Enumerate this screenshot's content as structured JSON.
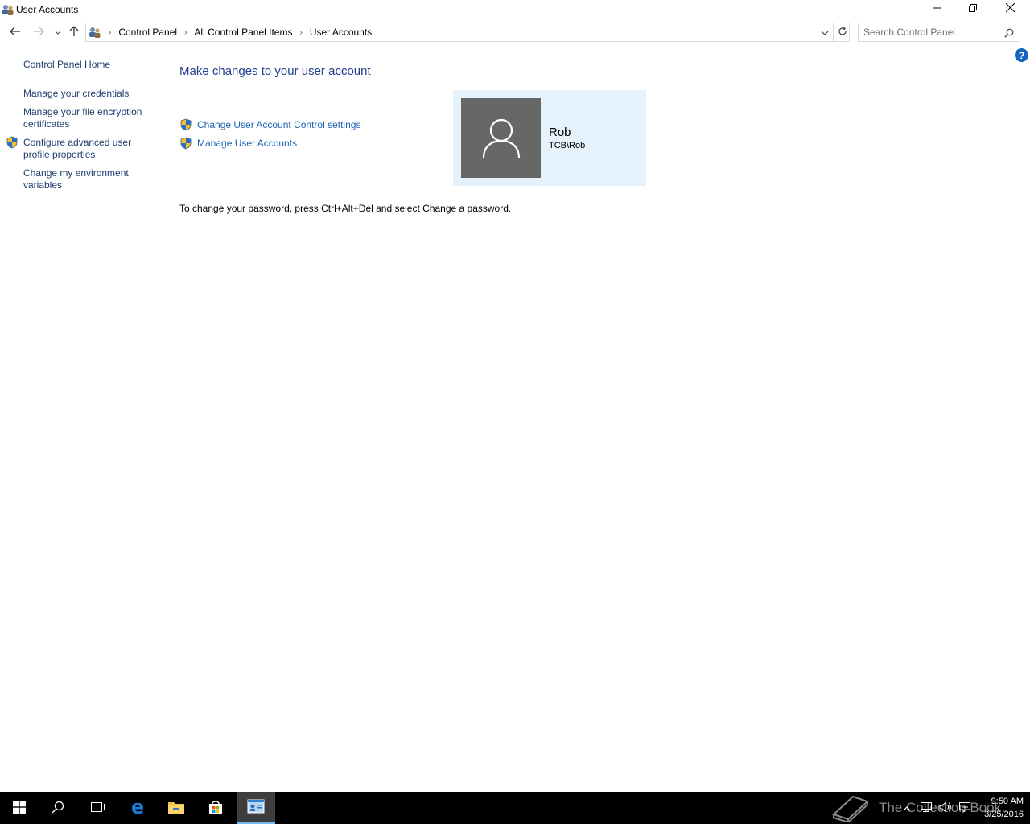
{
  "window": {
    "title": "User Accounts",
    "app_icon": "user-accounts-icon",
    "controls": {
      "minimize": "minimize-icon",
      "restore": "restore-icon",
      "close": "close-icon"
    }
  },
  "nav": {
    "breadcrumbs": [
      "Control Panel",
      "All Control Panel Items",
      "User Accounts"
    ],
    "search_placeholder": "Search Control Panel"
  },
  "sidebar": {
    "home": "Control Panel Home",
    "links": [
      "Manage your credentials",
      "Manage your file encryption certificates",
      "Configure advanced user profile properties",
      "Change my environment variables"
    ]
  },
  "main": {
    "heading": "Make changes to your user account",
    "tasks": [
      "Change User Account Control settings",
      "Manage User Accounts"
    ],
    "user": {
      "name": "Rob",
      "account": "TCB\\Rob"
    },
    "password_note": "To change your password, press Ctrl+Alt+Del and select Change a password."
  },
  "help_label": "?",
  "taskbar": {
    "time": "9:50 AM",
    "date": "3/25/2016",
    "watermark": "The Collection Book"
  },
  "colors": {
    "link": "#1e3e6f",
    "heading": "#1e3e8e",
    "user_panel": "#e5f1fb",
    "avatar_bg": "#676767",
    "taskbar": "#000000"
  }
}
